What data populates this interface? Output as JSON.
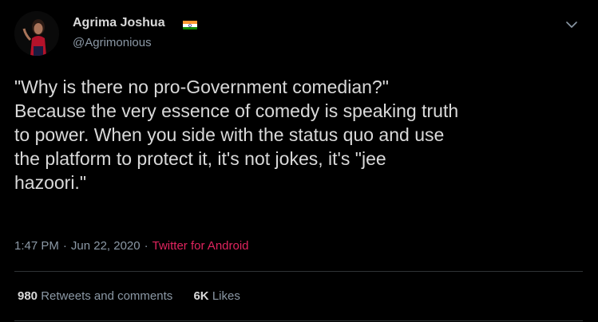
{
  "author": {
    "name": "Agrima Joshua",
    "handle": "@Agrimonious",
    "flag_icon": "india-flag-icon"
  },
  "header": {
    "more_icon": "chevron-down-icon"
  },
  "tweet": {
    "text": "\"Why is there no pro-Government comedian?\"\nBecause the very essence of comedy is speaking truth\nto power. When you side with the status quo and use\nthe platform to protect it, it's not jokes, it's \"jee\nhazoori.\""
  },
  "meta": {
    "time": "1:47 PM",
    "separator": "·",
    "date": "Jun 22, 2020",
    "source": "Twitter for Android"
  },
  "stats": {
    "retweets_count": "980",
    "retweets_label": "Retweets and comments",
    "likes_count": "6K",
    "likes_label": "Likes"
  },
  "colors": {
    "background": "#000000",
    "text": "#d9d9d9",
    "muted": "#8b98a5",
    "source_link": "#e0245e",
    "divider": "#2f3336"
  }
}
